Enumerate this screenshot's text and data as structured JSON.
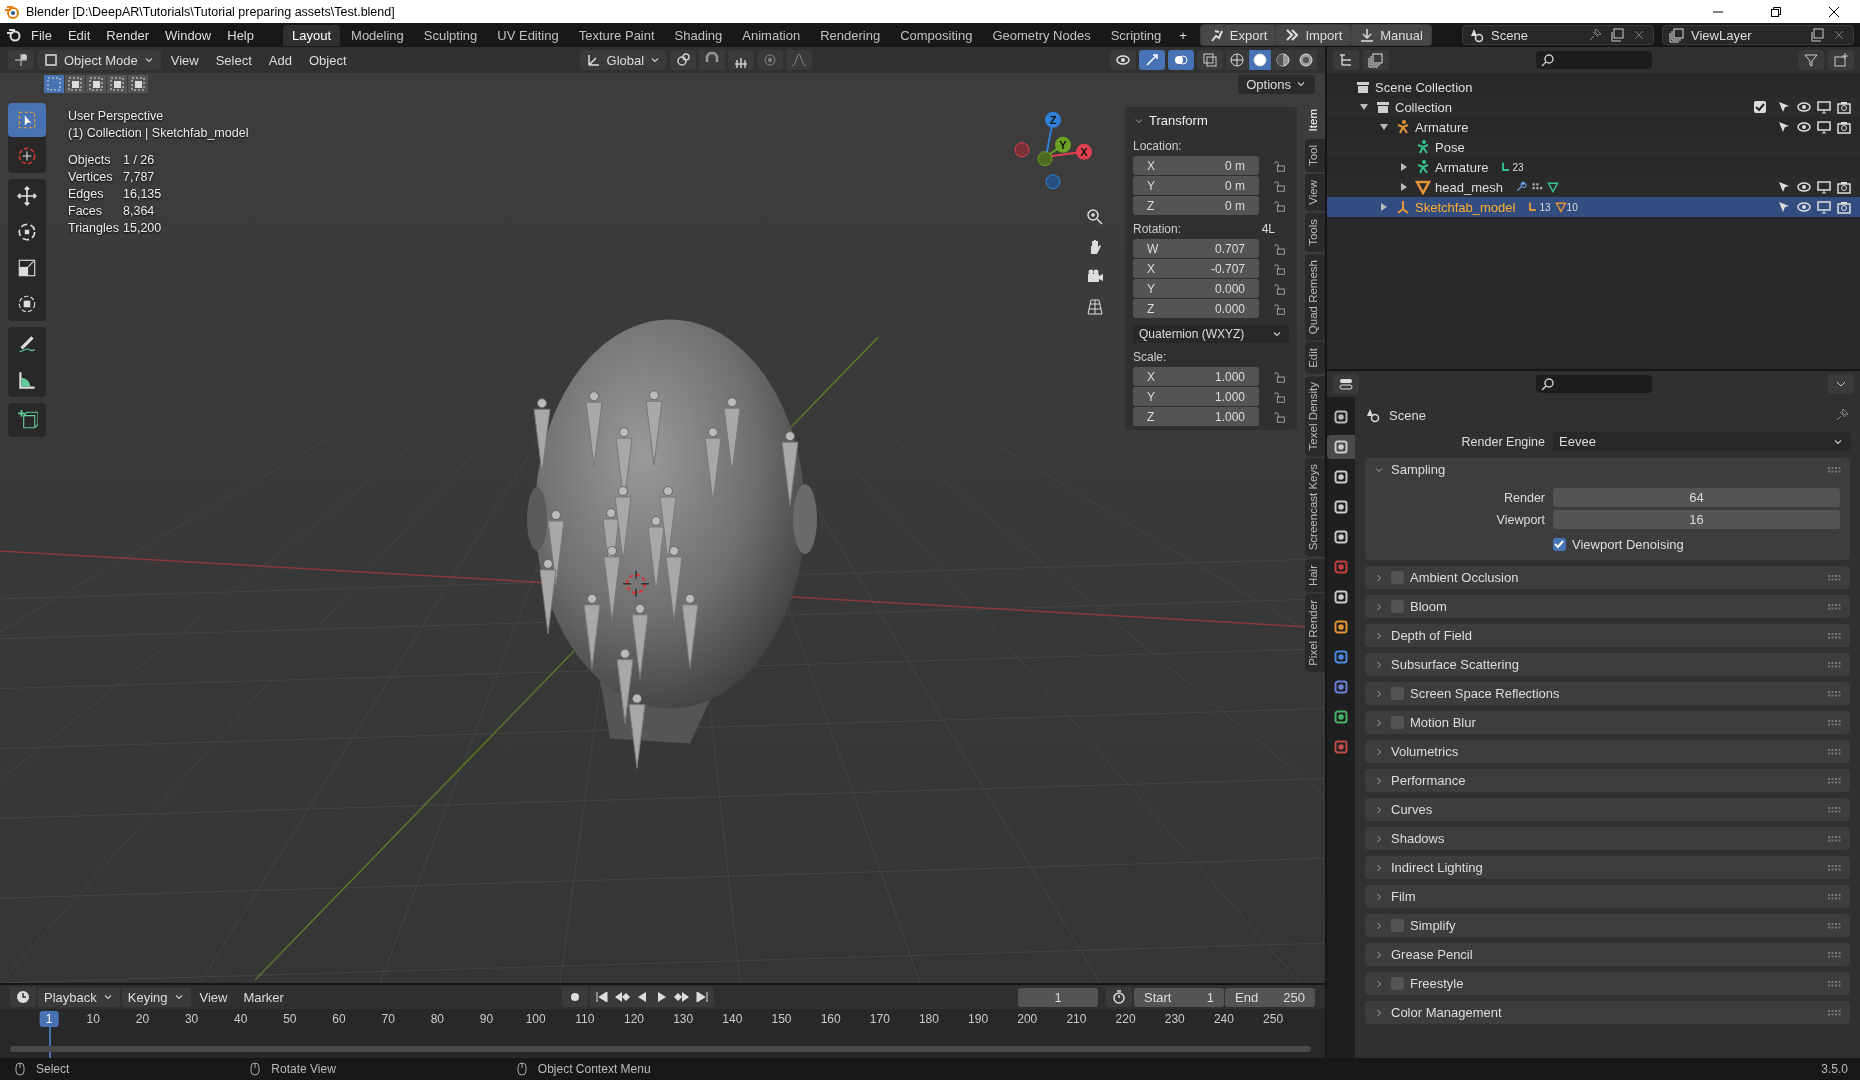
{
  "window": {
    "title": "Blender [D:\\DeepAR\\Tutorials\\Tutorial preparing assets\\Test.blend]"
  },
  "menu": [
    "File",
    "Edit",
    "Render",
    "Window",
    "Help"
  ],
  "workspaces": [
    {
      "label": "Layout",
      "selected": true
    },
    {
      "label": "Modeling",
      "selected": false
    },
    {
      "label": "Sculpting",
      "selected": false
    },
    {
      "label": "UV Editing",
      "selected": false
    },
    {
      "label": "Texture Paint",
      "selected": false
    },
    {
      "label": "Shading",
      "selected": false
    },
    {
      "label": "Animation",
      "selected": false
    },
    {
      "label": "Rendering",
      "selected": false
    },
    {
      "label": "Compositing",
      "selected": false
    },
    {
      "label": "Geometry Nodes",
      "selected": false
    },
    {
      "label": "Scripting",
      "selected": false
    }
  ],
  "add_workspace": "+",
  "top_buttons": [
    {
      "kind": "export",
      "label": "Export"
    },
    {
      "kind": "import",
      "label": "Import"
    },
    {
      "kind": "manual",
      "label": "Manual"
    }
  ],
  "scene_selector": {
    "value": "Scene"
  },
  "view_layer_selector": {
    "value": "ViewLayer"
  },
  "viewport": {
    "mode": "Object Mode",
    "menus": [
      "View",
      "Select",
      "Add",
      "Object"
    ],
    "orientation": "Global",
    "options": "Options",
    "selection_modes": [
      {
        "selected": true
      },
      {
        "selected": false
      },
      {
        "selected": false
      },
      {
        "selected": false
      },
      {
        "selected": false
      }
    ],
    "shading_modes": [
      {
        "kind": "wireframe",
        "selected": false
      },
      {
        "kind": "solid",
        "selected": true
      },
      {
        "kind": "material",
        "selected": false
      },
      {
        "kind": "rendered",
        "selected": false
      }
    ],
    "tools": [
      {
        "kind": "select",
        "selected": true
      },
      {
        "kind": "cursor",
        "selected": false
      },
      {
        "kind": "move",
        "selected": false
      },
      {
        "kind": "rotate",
        "selected": false
      },
      {
        "kind": "scale",
        "selected": false
      },
      {
        "kind": "transform",
        "selected": false
      },
      {
        "kind": "annotate",
        "selected": false
      },
      {
        "kind": "measure",
        "selected": false
      },
      {
        "kind": "add_cube",
        "selected": false
      }
    ],
    "info_title": "User Perspective",
    "info_context": "(1) Collection | Sketchfab_model",
    "stats": [
      {
        "label": "Objects",
        "value": "1 / 26"
      },
      {
        "label": "Vertices",
        "value": "7,787"
      },
      {
        "label": "Edges",
        "value": "16,135"
      },
      {
        "label": "Faces",
        "value": "8,364"
      },
      {
        "label": "Triangles",
        "value": "15,200"
      }
    ],
    "gizmo_axes": [
      {
        "label": "Z",
        "color": "#2f7fd8"
      },
      {
        "label": "Y",
        "color": "#6aa223"
      },
      {
        "label": "X",
        "color": "#e0404f"
      }
    ],
    "nav_buttons": [
      {
        "kind": "zoom"
      },
      {
        "kind": "pan"
      },
      {
        "kind": "camera"
      },
      {
        "kind": "grid"
      }
    ]
  },
  "sidebar": {
    "panel_title": "Transform",
    "location_label": "Location:",
    "location": [
      {
        "axis": "X",
        "value": "0 m"
      },
      {
        "axis": "Y",
        "value": "0 m"
      },
      {
        "axis": "Z",
        "value": "0 m"
      }
    ],
    "rotation_label": "Rotation:",
    "rotation_tag": "4L",
    "rotation": [
      {
        "axis": "W",
        "value": "0.707"
      },
      {
        "axis": "X",
        "value": "-0.707"
      },
      {
        "axis": "Y",
        "value": "0.000"
      },
      {
        "axis": "Z",
        "value": "0.000"
      }
    ],
    "rotation_mode": "Quaternion (WXYZ)",
    "scale_label": "Scale:",
    "scale": [
      {
        "axis": "X",
        "value": "1.000"
      },
      {
        "axis": "Y",
        "value": "1.000"
      },
      {
        "axis": "Z",
        "value": "1.000"
      }
    ]
  },
  "sidebar_tabs": [
    {
      "label": "Item",
      "selected": true
    },
    {
      "label": "Tool",
      "selected": false
    },
    {
      "label": "View",
      "selected": false
    },
    {
      "label": "Tools",
      "selected": false
    },
    {
      "label": "Quad Remesh",
      "selected": false
    },
    {
      "label": "Edit",
      "selected": false
    },
    {
      "label": "Texel Density",
      "selected": false
    },
    {
      "label": "Screencast Keys",
      "selected": false
    },
    {
      "label": "Hair",
      "selected": false
    },
    {
      "label": "Pixel Render",
      "selected": false
    }
  ],
  "outliner": {
    "items": [
      {
        "name": "Scene Collection",
        "kind": "scene_collection",
        "selected": false,
        "toggles": false,
        "children": [
          {
            "name": "Collection",
            "kind": "collection",
            "expanded": true,
            "selected": false,
            "toggles": true,
            "checked": true,
            "children": [
              {
                "name": "Armature",
                "kind": "armature",
                "expanded": true,
                "selected": false,
                "toggles": true,
                "children": [
                  {
                    "name": "Pose",
                    "kind": "pose",
                    "selected": false,
                    "toggles": false
                  },
                  {
                    "name": "Armature",
                    "kind": "armature_data",
                    "expanded": false,
                    "selected": false,
                    "toggles": false,
                    "badges": [
                      {
                        "kind": "bone",
                        "count": "23"
                      }
                    ]
                  },
                  {
                    "name": "head_mesh",
                    "kind": "mesh",
                    "expanded": false,
                    "selected": false,
                    "toggles": true,
                    "badges": [
                      {
                        "kind": "wrench"
                      },
                      {
                        "kind": "particles"
                      },
                      {
                        "kind": "vertex_group"
                      }
                    ]
                  }
                ]
              },
              {
                "name": "Sketchfab_model",
                "kind": "empty",
                "expanded": false,
                "selected": true,
                "toggles": true,
                "badges": [
                  {
                    "kind": "armature",
                    "count": "13"
                  },
                  {
                    "kind": "mesh",
                    "count": "10"
                  }
                ]
              }
            ]
          }
        ]
      }
    ]
  },
  "properties": {
    "tabs": [
      {
        "kind": "tool",
        "selected": false
      },
      {
        "kind": "render",
        "selected": true
      },
      {
        "kind": "output",
        "selected": false
      },
      {
        "kind": "view_layer",
        "selected": false
      },
      {
        "kind": "scene",
        "selected": false
      },
      {
        "kind": "world",
        "selected": false
      },
      {
        "kind": "collection",
        "selected": false
      },
      {
        "kind": "object",
        "selected": false
      },
      {
        "kind": "physics",
        "selected": false
      },
      {
        "kind": "constraints",
        "selected": false
      },
      {
        "kind": "data",
        "selected": false
      },
      {
        "kind": "texture",
        "selected": false
      }
    ],
    "context": "Scene",
    "engine_label": "Render Engine",
    "engine": "Eevee",
    "panels": [
      {
        "title": "Sampling",
        "kind": "plain",
        "expanded": true,
        "fields": [
          {
            "label": "Render",
            "value": "64"
          },
          {
            "label": "Viewport",
            "value": "16"
          }
        ],
        "option": {
          "label": "Viewport Denoising",
          "checked": true
        }
      },
      {
        "title": "Ambient Occlusion",
        "kind": "checkbox",
        "checked": false,
        "expanded": false
      },
      {
        "title": "Bloom",
        "kind": "checkbox",
        "checked": false,
        "expanded": false
      },
      {
        "title": "Depth of Field",
        "kind": "plain",
        "expanded": false
      },
      {
        "title": "Subsurface Scattering",
        "kind": "plain",
        "expanded": false
      },
      {
        "title": "Screen Space Reflections",
        "kind": "checkbox",
        "checked": false,
        "expanded": false
      },
      {
        "title": "Motion Blur",
        "kind": "checkbox",
        "checked": false,
        "expanded": false
      },
      {
        "title": "Volumetrics",
        "kind": "plain",
        "expanded": false
      },
      {
        "title": "Performance",
        "kind": "plain",
        "expanded": false
      },
      {
        "title": "Curves",
        "kind": "plain",
        "expanded": false
      },
      {
        "title": "Shadows",
        "kind": "plain",
        "expanded": false
      },
      {
        "title": "Indirect Lighting",
        "kind": "plain",
        "expanded": false
      },
      {
        "title": "Film",
        "kind": "plain",
        "expanded": false
      },
      {
        "title": "Simplify",
        "kind": "checkbox",
        "checked": false,
        "expanded": false
      },
      {
        "title": "Grease Pencil",
        "kind": "plain",
        "expanded": false
      },
      {
        "title": "Freestyle",
        "kind": "checkbox",
        "checked": false,
        "expanded": false
      },
      {
        "title": "Color Management",
        "kind": "plain",
        "expanded": false
      }
    ]
  },
  "timeline": {
    "menus": [
      "Playback",
      "Keying",
      "View",
      "Marker"
    ],
    "current_frame": "1",
    "start_label": "Start",
    "start": "1",
    "end_label": "End",
    "end": "250",
    "ruler": [
      {
        "label": "1",
        "selected": true
      },
      {
        "label": "10",
        "selected": false
      },
      {
        "label": "20",
        "selected": false
      },
      {
        "label": "30",
        "selected": false
      },
      {
        "label": "40",
        "selected": false
      },
      {
        "label": "50",
        "selected": false
      },
      {
        "label": "60",
        "selected": false
      },
      {
        "label": "70",
        "selected": false
      },
      {
        "label": "80",
        "selected": false
      },
      {
        "label": "90",
        "selected": false
      },
      {
        "label": "100",
        "selected": false
      },
      {
        "label": "110",
        "selected": false
      },
      {
        "label": "120",
        "selected": false
      },
      {
        "label": "130",
        "selected": false
      },
      {
        "label": "140",
        "selected": false
      },
      {
        "label": "150",
        "selected": false
      },
      {
        "label": "160",
        "selected": false
      },
      {
        "label": "170",
        "selected": false
      },
      {
        "label": "180",
        "selected": false
      },
      {
        "label": "190",
        "selected": false
      },
      {
        "label": "200",
        "selected": false
      },
      {
        "label": "210",
        "selected": false
      },
      {
        "label": "220",
        "selected": false
      },
      {
        "label": "230",
        "selected": false
      },
      {
        "label": "240",
        "selected": false
      },
      {
        "label": "250",
        "selected": false
      }
    ]
  },
  "status_bar": {
    "hints": [
      "Select",
      "Rotate View",
      "Object Context Menu"
    ],
    "version": "3.5.0"
  }
}
